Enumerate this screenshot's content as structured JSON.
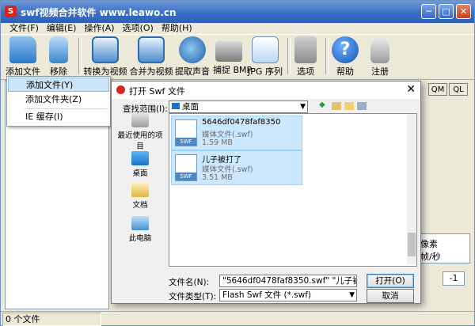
{
  "window": {
    "title": "swf视频合并软件 www.leawo.cn",
    "min_label": "─",
    "max_label": "□",
    "close_label": "✕"
  },
  "menu": [
    "文件(F)",
    "编辑(E)",
    "操作(A)",
    "选项(O)",
    "帮助(H)"
  ],
  "toolbar": {
    "add_file": "添加文件",
    "remove": "移除",
    "convert_video": "转换为视频",
    "merge_video": "合并为视频",
    "extract_sound": "提取声音",
    "capture_bmp": "捕捉 BMP",
    "jpg_sequence": "JPG 序列",
    "options": "选项",
    "help": "帮助",
    "register": "注册"
  },
  "right_buttons": [
    "QM",
    "QL"
  ],
  "right_box": {
    "line1": "像素",
    "line2": "帧/秒"
  },
  "spin_value": "-1",
  "status": {
    "count": "0 个文件"
  },
  "popup_menu": {
    "items": [
      "添加文件(Y)",
      "添加文件夹(Z)",
      "IE 缓存(I)"
    ]
  },
  "dialog": {
    "title": "打开 Swf 文件",
    "look_in_label": "查找范围(I):",
    "look_in_value": "桌面",
    "places": [
      "最近使用的项目",
      "桌面",
      "文档",
      "此电脑"
    ],
    "files": [
      {
        "name": "5646df0478faf8350",
        "type": "媒体文件(.swf)",
        "size": "1.59 MB",
        "badge": "SWF"
      },
      {
        "name": "儿子被打了",
        "type": "媒体文件(.swf)",
        "size": "3.51 MB",
        "badge": "SWF"
      }
    ],
    "filename_label": "文件名(N):",
    "filename_value": "\"5646df0478faf8350.swf\" \"儿子被打了.swf\"",
    "filetype_label": "文件类型(T):",
    "filetype_value": "Flash Swf 文件 (*.swf)",
    "open_button": "打开(O)",
    "cancel_button": "取消",
    "close_label": "✕"
  },
  "colors": {
    "titlebar": "#3a6fc6",
    "selection": "#cce8ff",
    "accent": "#d8241e"
  }
}
